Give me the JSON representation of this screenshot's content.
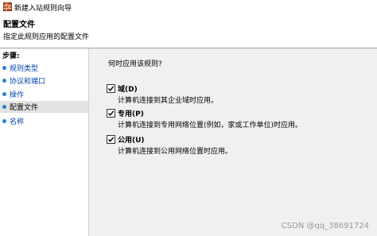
{
  "window": {
    "title": "新建入站规则向导"
  },
  "header": {
    "title": "配置文件",
    "subtitle": "指定此规则应用的配置文件"
  },
  "sidebar": {
    "steps_label": "步骤:",
    "items": [
      {
        "label": "规则类型"
      },
      {
        "label": "协议和端口"
      },
      {
        "label": "操作"
      },
      {
        "label": "配置文件"
      },
      {
        "label": "名称"
      }
    ],
    "active_index": 3
  },
  "main": {
    "question": "何时应用该规则?",
    "options": [
      {
        "label": "域(D)",
        "description": "计算机连接到其企业域时应用。",
        "checked": true
      },
      {
        "label": "专用(P)",
        "description": "计算机连接到专用网络位置(例如，家或工作单位)时应用。",
        "checked": true
      },
      {
        "label": "公用(U)",
        "description": "计算机连接到公用网络位置时应用。",
        "checked": true
      }
    ]
  },
  "watermark": "CSDN @qq_38691724",
  "colors": {
    "accent": "#2a7ed8",
    "link": "#0645ad",
    "panel": "#f0f0f0",
    "selected": "#e3e3e3"
  },
  "icons": {
    "app": "firewall-app-icon",
    "step": "step-bullet-icon",
    "check": "checkmark-icon"
  }
}
